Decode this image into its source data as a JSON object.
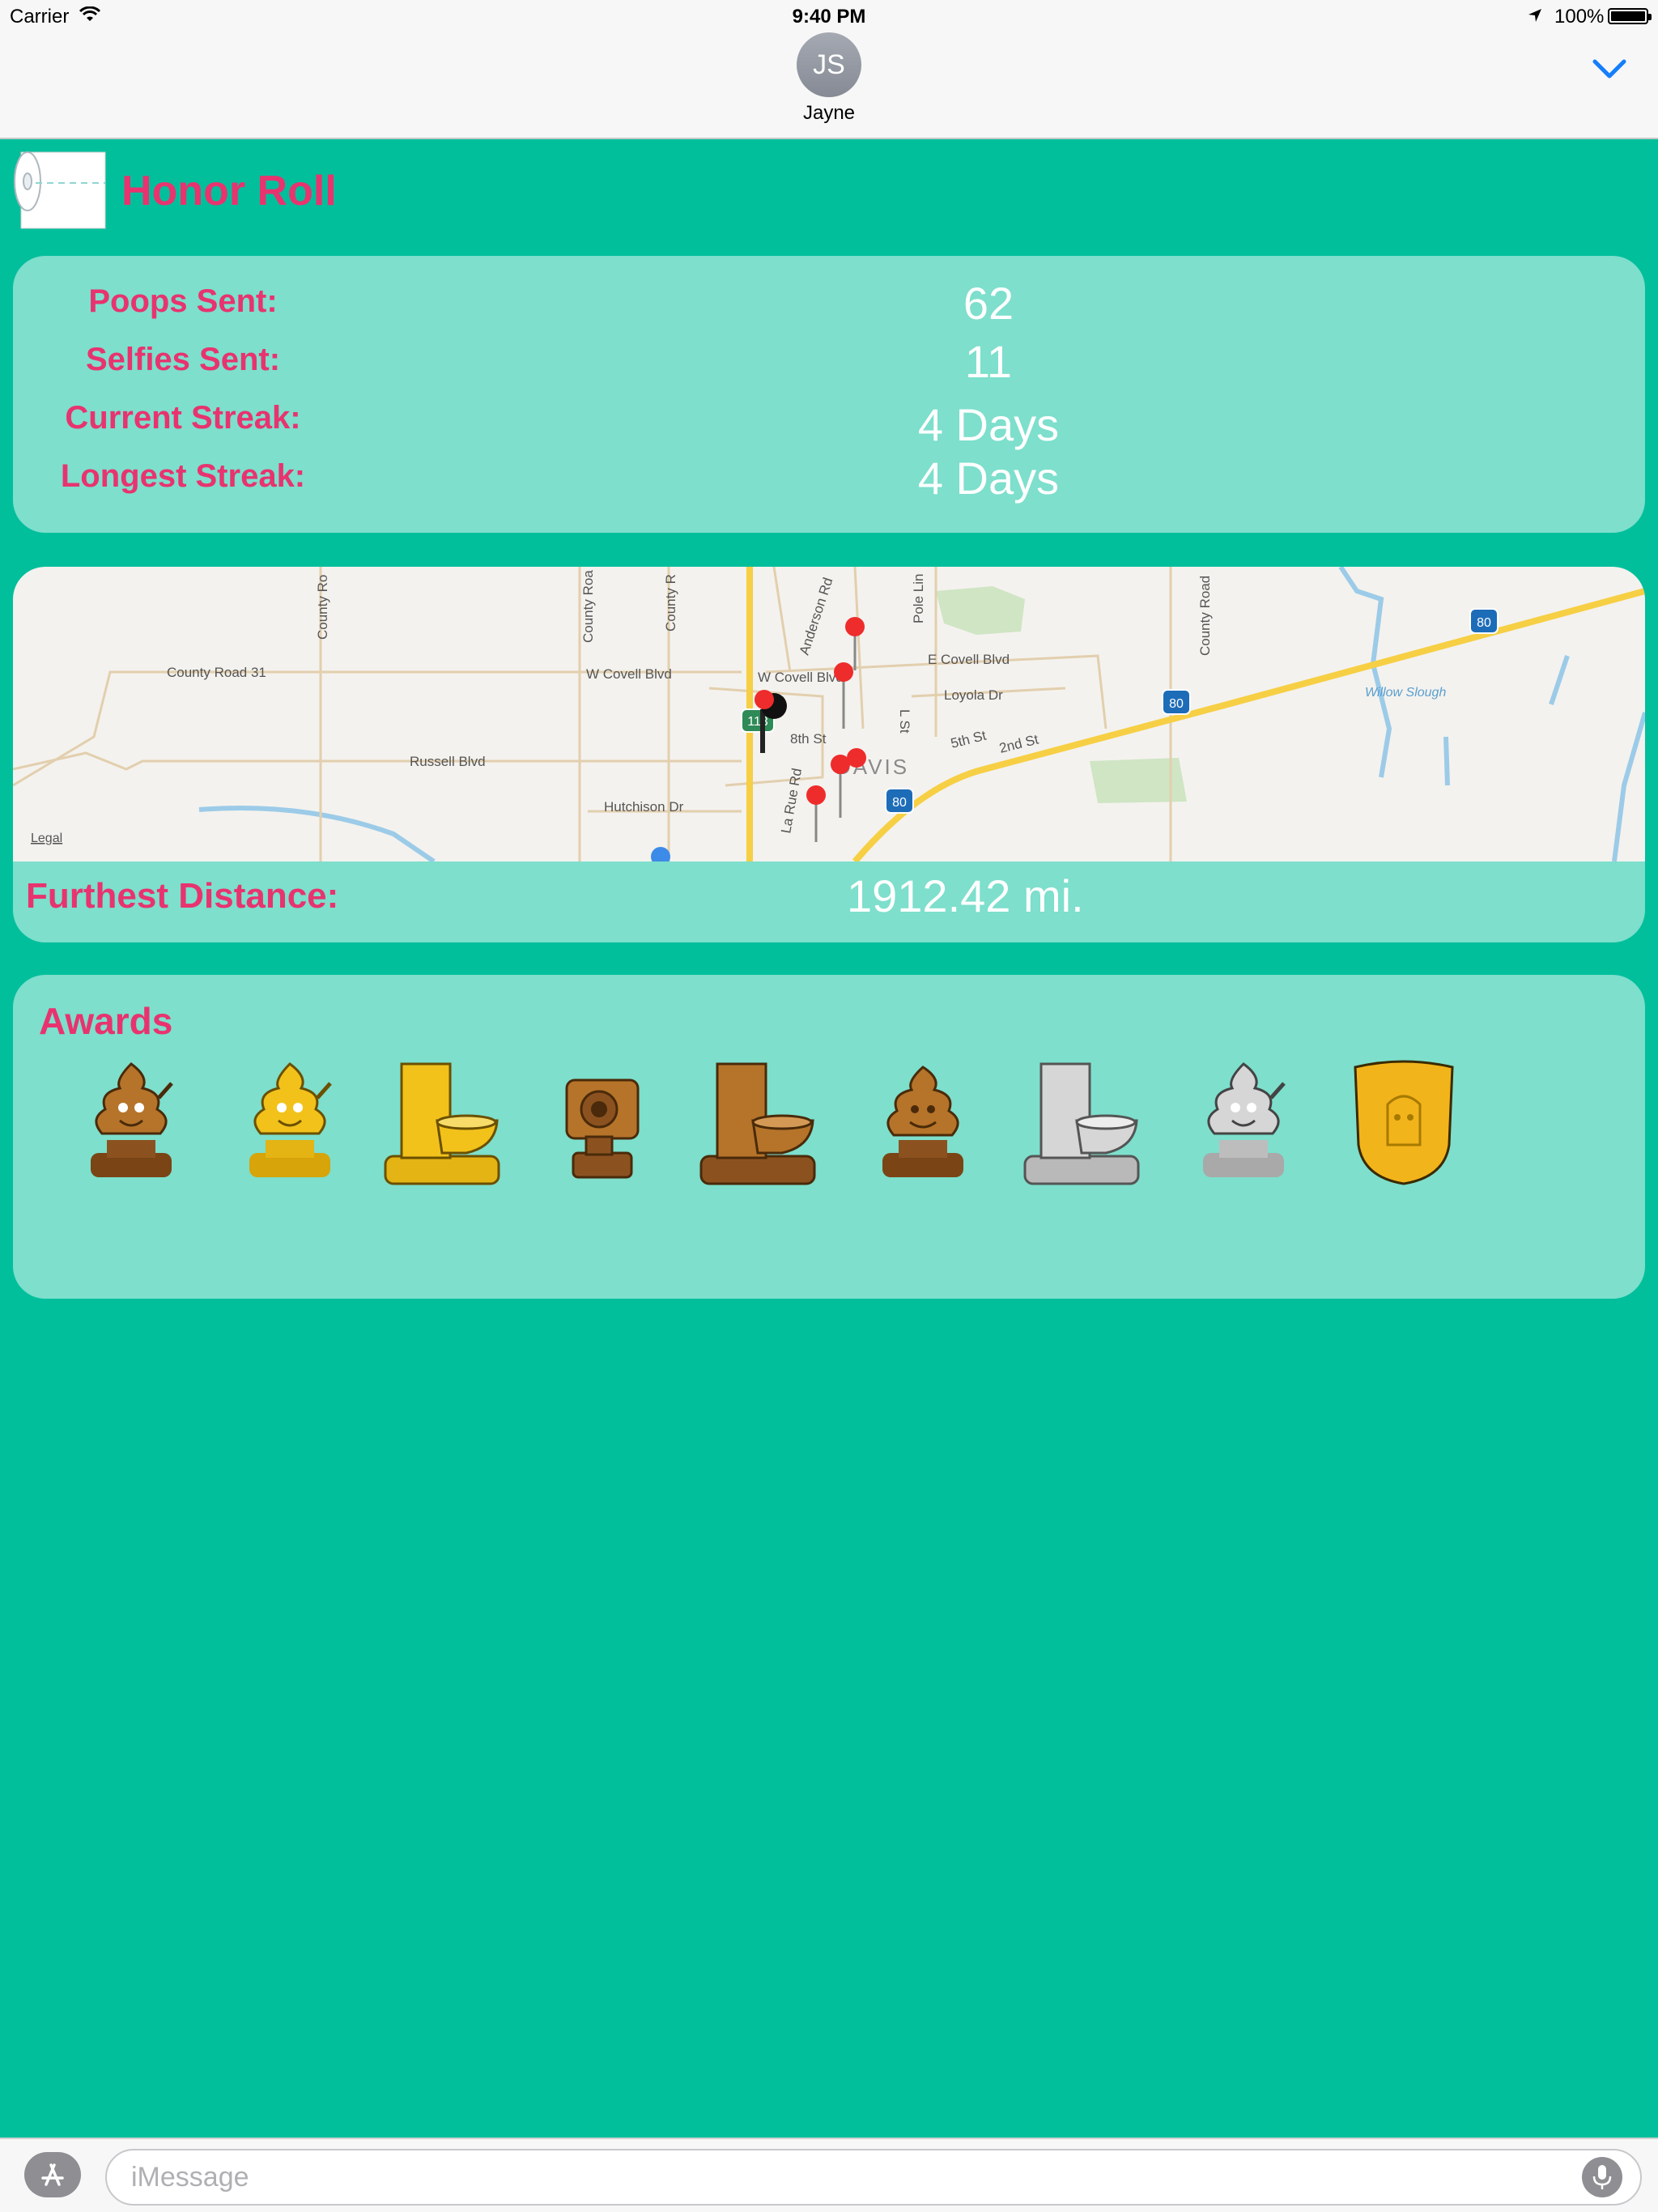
{
  "status_bar": {
    "carrier": "Carrier",
    "time": "9:40 PM",
    "battery_percent": "100%"
  },
  "header": {
    "contact_initials": "JS",
    "contact_name": "Jayne"
  },
  "honor_roll": {
    "title": "Honor Roll"
  },
  "stats": [
    {
      "label": "Poops Sent:",
      "value": "62"
    },
    {
      "label": "Selfies Sent:",
      "value": "11"
    },
    {
      "label": "Current Streak:",
      "value": "4 Days"
    },
    {
      "label": "Longest Streak:",
      "value": "4 Days"
    }
  ],
  "map": {
    "labels": {
      "county_road_31": "County Road 31",
      "russell_blvd": "Russell Blvd",
      "w_covell_blvd_left": "W Covell Blvd",
      "w_covell_blvd": "W Covell Blvd",
      "e_covell_blvd": "E Covell Blvd",
      "loyola_dr": "Loyola Dr",
      "hutchison_dr": "Hutchison Dr",
      "anderson_rd": "Anderson Rd",
      "pole_line": "Pole Lin",
      "l_st": "L St",
      "fifth_st": "5th St",
      "second_st": "2nd St",
      "eighth_st": "8th St",
      "la_rue_rd": "La Rue Rd",
      "davis": "DAVIS",
      "county_rd_a": "County Ro",
      "county_rd_b": "County Roa",
      "county_rd_c": "County R",
      "county_road_right": "County Road",
      "willow_slough": "Willow Slough",
      "legal": "Legal",
      "shield_80": "80",
      "shield_113": "113"
    }
  },
  "distance": {
    "label": "Furthest Distance:",
    "value": "1912.42 mi."
  },
  "awards": {
    "title": "Awards",
    "items": [
      {
        "name": "bronze-poop-trophy",
        "color": "#b5742a"
      },
      {
        "name": "gold-poop-trophy",
        "color": "#f2c21b"
      },
      {
        "name": "gold-toilet-trophy",
        "color": "#f2c21b"
      },
      {
        "name": "bronze-camera-trophy",
        "color": "#b5742a"
      },
      {
        "name": "bronze-toilet-trophy",
        "color": "#b5742a"
      },
      {
        "name": "bronze-smile-poop-trophy",
        "color": "#b5742a"
      },
      {
        "name": "silver-toilet-trophy",
        "color": "#c9c9c9"
      },
      {
        "name": "silver-poop-trophy",
        "color": "#c9c9c9"
      },
      {
        "name": "gold-shield-trophy",
        "color": "#f2b41b"
      }
    ]
  },
  "input": {
    "placeholder": "iMessage"
  },
  "colors": {
    "background": "#02bf9c",
    "card": "#7ddfcc",
    "accent": "#e8336f",
    "link_blue": "#147efb"
  }
}
